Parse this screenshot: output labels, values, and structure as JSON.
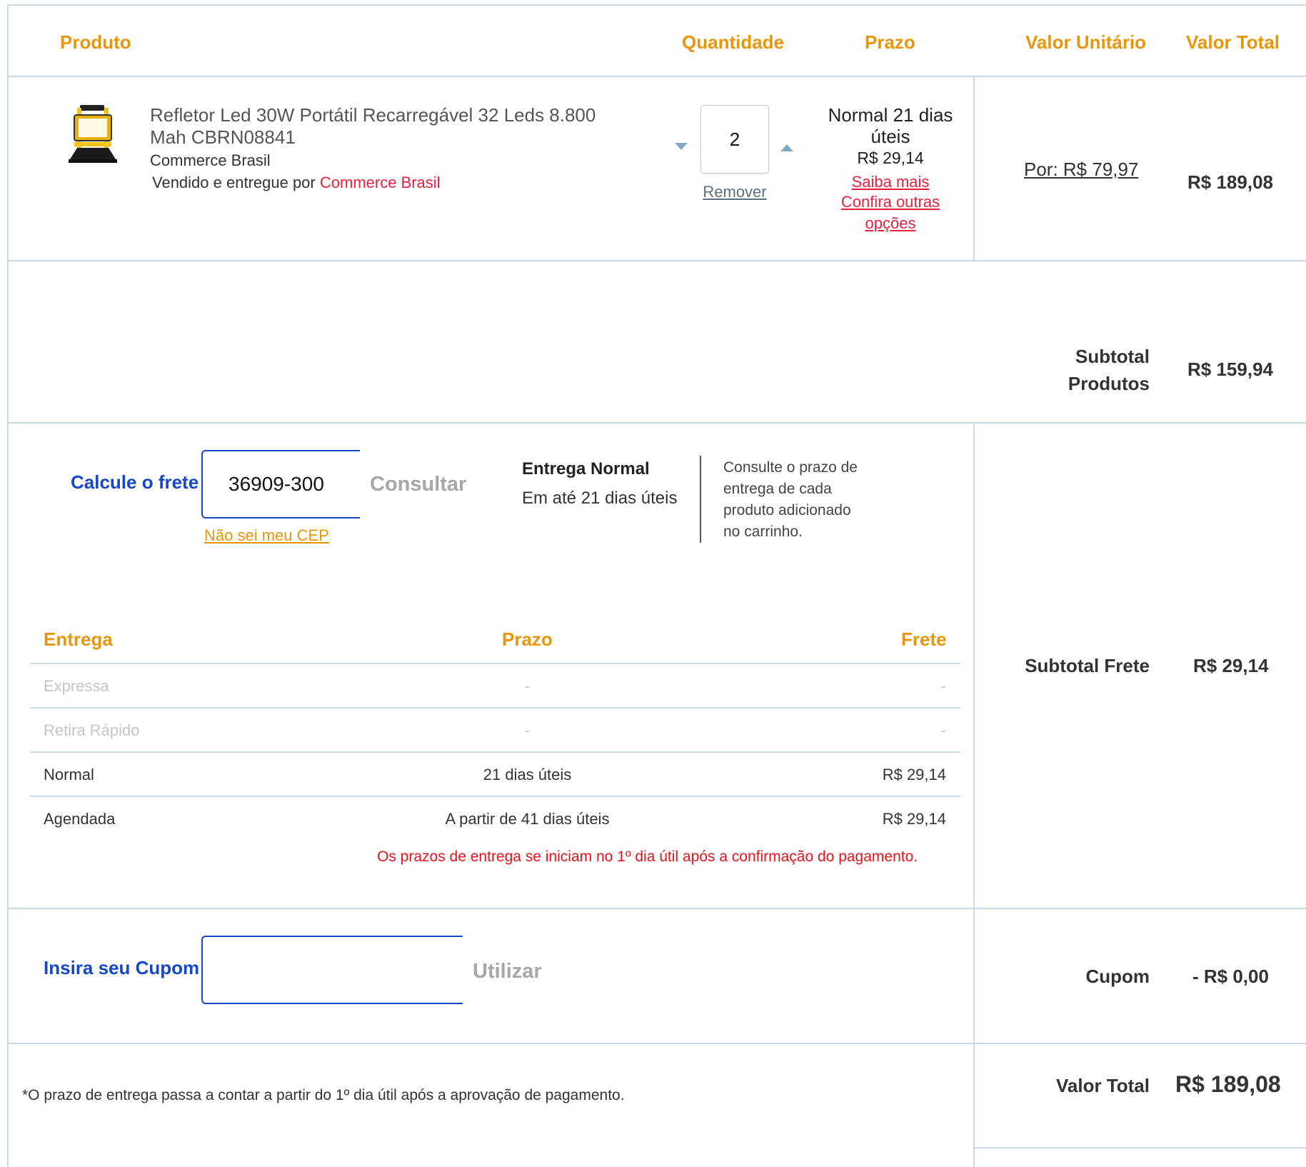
{
  "table_header": {
    "produto": "Produto",
    "quantidade": "Quantidade",
    "prazo": "Prazo",
    "valor_unitario": "Valor Unitário",
    "valor_total": "Valor Total"
  },
  "item": {
    "title_line1": "Refletor Led 30W Portátil Recarregável 32 Leds 8.800",
    "title_line2": "Mah CBRN08841",
    "brand": "Commerce Brasil",
    "sold_by_prefix": "Vendido e entregue por",
    "sold_by": "Commerce Brasil",
    "quantity": "2",
    "remove_label": "Remover",
    "prazo_line1": "Normal 21 dias",
    "prazo_line2": "úteis",
    "prazo_price": "R$ 29,14",
    "saiba_mais": "Saiba mais",
    "confira_line1": "Confira outras",
    "confira_line2": "opções",
    "unit_price": "Por: R$ 79,97",
    "total_price": "R$ 189,08"
  },
  "subtotal_produtos": {
    "label_line1": "Subtotal",
    "label_line2": "Produtos",
    "value": "R$ 159,94"
  },
  "frete": {
    "label": "Calcule o frete",
    "cep_value": "36909-300",
    "consultar_label": "Consultar",
    "nao_sei_cep": "Não sei meu CEP",
    "entrega_title": "Entrega Normal",
    "entrega_sub": "Em até 21 dias úteis",
    "info_line1": "Consulte o prazo de",
    "info_line2": "entrega de cada",
    "info_line3": "produto adicionado",
    "info_line4": "no carrinho.",
    "table_headers": {
      "entrega": "Entrega",
      "prazo": "Prazo",
      "frete": "Frete"
    },
    "rows": [
      {
        "entrega": "Expressa",
        "prazo": "-",
        "frete": "-"
      },
      {
        "entrega": "Retira Rápido",
        "prazo": "-",
        "frete": "-"
      },
      {
        "entrega": "Normal",
        "prazo": "21 dias úteis",
        "frete": "R$ 29,14"
      },
      {
        "entrega": "Agendada",
        "prazo": "A partir de 41 dias úteis",
        "frete": "R$ 29,14"
      }
    ],
    "notice": "Os prazos de entrega se iniciam no 1º dia útil após a confirmação do pagamento.",
    "subtotal_label": "Subtotal Frete",
    "subtotal_value": "R$ 29,14"
  },
  "cupom": {
    "label": "Insira seu Cupom",
    "input_value": "",
    "button_label": "Utilizar",
    "total_label": "Cupom",
    "total_value": "- R$ 0,00"
  },
  "footer": {
    "note": "*O prazo de entrega passa a contar a partir do 1º dia útil após a aprovação de pagamento.",
    "total_label": "Valor Total",
    "total_value": "R$ 189,08"
  },
  "colors": {
    "accent_orange": "#e8960c",
    "link_red": "#e8213e",
    "blue": "#1547c9",
    "border": "#cad9e6"
  }
}
